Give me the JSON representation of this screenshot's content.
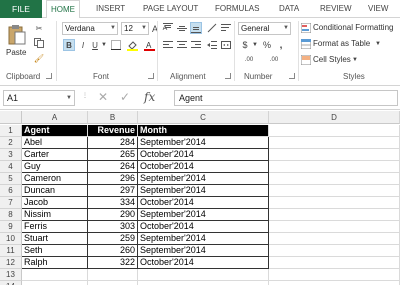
{
  "tabs": {
    "file": "FILE",
    "items": [
      "HOME",
      "INSERT",
      "PAGE LAYOUT",
      "FORMULAS",
      "DATA",
      "REVIEW",
      "VIEW"
    ]
  },
  "ribbon": {
    "clipboard": {
      "paste": "Paste",
      "label": "Clipboard"
    },
    "font": {
      "name": "Verdana",
      "size": "12",
      "bold": "B",
      "italic": "I",
      "underline": "U",
      "grow": "A",
      "shrink": "A",
      "label": "Font"
    },
    "alignment": {
      "label": "Alignment"
    },
    "number": {
      "format": "General",
      "currency": "$",
      "percent": "%",
      "comma": ",",
      "inc_decimal": ".00",
      "dec_decimal": ".00",
      "label": "Number"
    },
    "styles": {
      "conditional": "Conditional Formatting",
      "format_table": "Format as Table",
      "cell_styles": "Cell Styles",
      "label": "Styles"
    }
  },
  "formula_bar": {
    "name_box": "A1",
    "fx": "fx",
    "formula": "Agent"
  },
  "columns": [
    "A",
    "B",
    "C",
    "D"
  ],
  "rows": [
    "1",
    "2",
    "3",
    "4",
    "5",
    "6",
    "7",
    "8",
    "9",
    "10",
    "11",
    "12",
    "13",
    "14"
  ],
  "table": {
    "headers": [
      "Agent",
      "Revenue",
      "Month"
    ],
    "rows": [
      [
        "Abel",
        "284",
        "September'2014"
      ],
      [
        "Carter",
        "265",
        "October'2014"
      ],
      [
        "Guy",
        "264",
        "October'2014"
      ],
      [
        "Cameron",
        "296",
        "September'2014"
      ],
      [
        "Duncan",
        "297",
        "September'2014"
      ],
      [
        "Jacob",
        "334",
        "October'2014"
      ],
      [
        "Nissim",
        "290",
        "September'2014"
      ],
      [
        "Ferris",
        "303",
        "October'2014"
      ],
      [
        "Stuart",
        "259",
        "September'2014"
      ],
      [
        "Seth",
        "260",
        "September'2014"
      ],
      [
        "Ralph",
        "322",
        "October'2014"
      ]
    ]
  },
  "colors": {
    "accent": "#217346",
    "header_fill": "#000000"
  }
}
